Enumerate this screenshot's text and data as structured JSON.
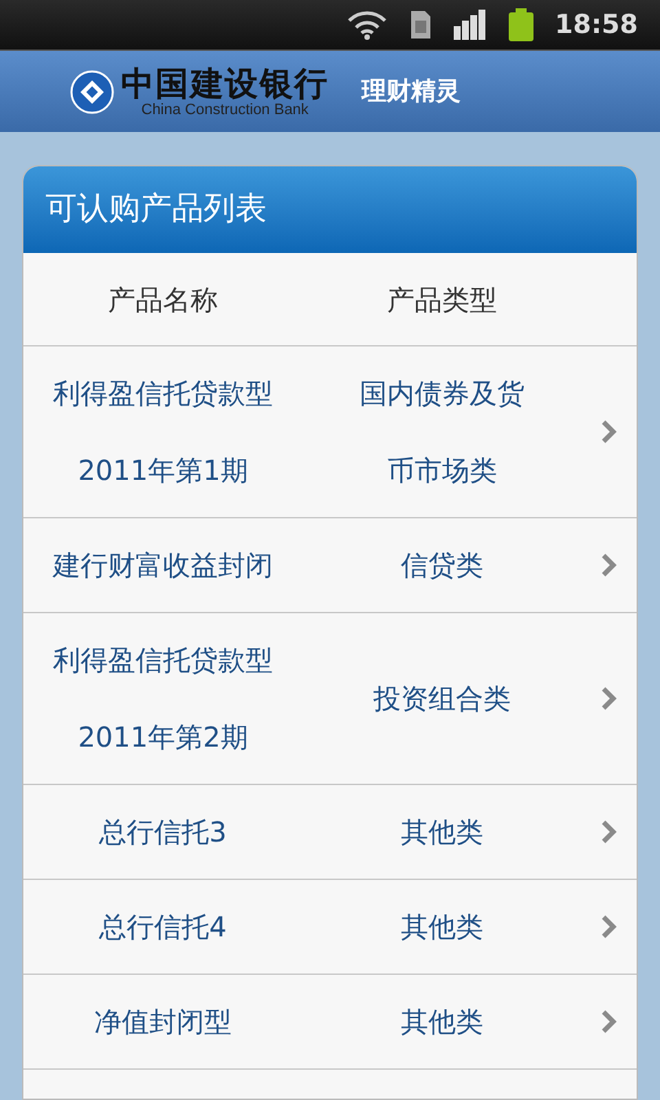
{
  "status_bar": {
    "time": "18:58"
  },
  "header": {
    "bank_name": "中国建设银行",
    "bank_name_en": "China Construction Bank",
    "app_title": "理财精灵"
  },
  "card": {
    "title": "可认购产品列表",
    "columns": [
      "产品名称",
      "产品类型"
    ],
    "rows": [
      {
        "name": [
          "利得盈信托贷款型",
          "2011年第1期"
        ],
        "type": [
          "国内债券及货",
          "币市场类"
        ]
      },
      {
        "name": [
          "建行财富收益封闭"
        ],
        "type": [
          "信贷类"
        ]
      },
      {
        "name": [
          "利得盈信托贷款型",
          "2011年第2期"
        ],
        "type": [
          "投资组合类"
        ]
      },
      {
        "name": [
          "总行信托3"
        ],
        "type": [
          "其他类"
        ]
      },
      {
        "name": [
          "总行信托4"
        ],
        "type": [
          "其他类"
        ]
      },
      {
        "name": [
          "净值封闭型"
        ],
        "type": [
          "其他类"
        ]
      }
    ]
  }
}
